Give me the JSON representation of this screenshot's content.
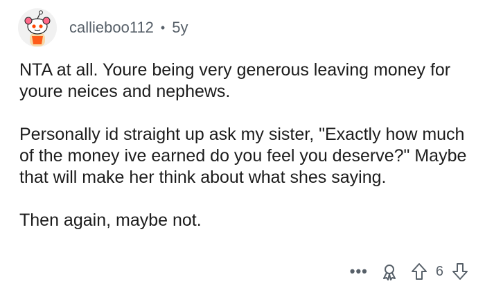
{
  "comment": {
    "author": "callieboo112",
    "separator": "•",
    "age": "5y",
    "paragraphs": [
      "NTA at all. Youre being very generous leaving money for youre neices and nephews.",
      "Personally id straight up ask my sister, \"Exactly how much of the money ive earned do you feel you deserve?\"  Maybe that will make her think about what shes saying.",
      "Then again, maybe not."
    ],
    "score": "6"
  },
  "actions": {
    "more_label": "•••",
    "icons": [
      "award-icon",
      "upvote-icon",
      "downvote-icon"
    ]
  },
  "colors": {
    "text": "#1c1c1c",
    "meta": "#576069",
    "avatar_accent": "#ff4500"
  }
}
